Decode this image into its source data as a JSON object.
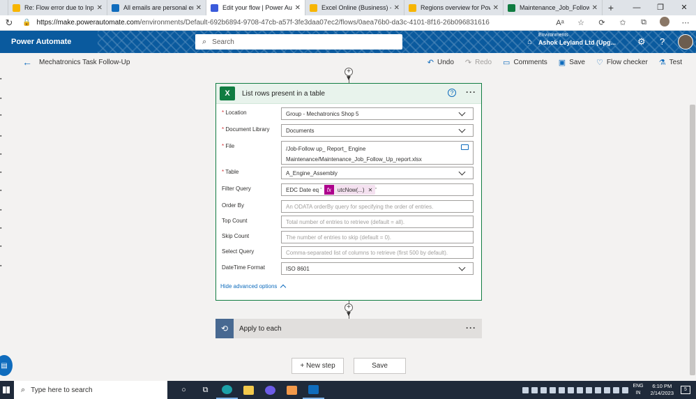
{
  "browser": {
    "tabs": [
      {
        "label": "Re: Flow error due to Input file",
        "color": "#f7b500"
      },
      {
        "label": "All emails are personal emails",
        "color": "#0f6cbd"
      },
      {
        "label": "Edit your flow | Power Automate",
        "color": "#3b5bdb",
        "active": true
      },
      {
        "label": "Excel Online (Business) - Conn",
        "color": "#f7b500"
      },
      {
        "label": "Regions overview for Power Au",
        "color": "#f7b500"
      },
      {
        "label": "Maintenance_Job_Follow_Up",
        "color": "#107c41"
      }
    ],
    "url_host": "https://make.powerautomate.com",
    "url_path": "/environments/Default-692b6894-9708-47cb-a57f-3fe3daa07ec2/flows/0aea76b0-da3c-4101-8f16-26b096831616"
  },
  "header": {
    "app_name": "Power Automate",
    "search_placeholder": "Search",
    "env_label": "Environments",
    "env_name": "Ashok Leyland Ltd (Upg..."
  },
  "cmdbar": {
    "flow_name": "Mechatronics Task Follow-Up",
    "undo": "Undo",
    "redo": "Redo",
    "comments": "Comments",
    "save": "Save",
    "flow_checker": "Flow checker",
    "test": "Test"
  },
  "action": {
    "title": "List rows present in a table",
    "location_label": "Location",
    "location_value": "Group - Mechatronics Shop 5",
    "doclib_label": "Document Library",
    "doclib_value": "Documents",
    "file_label": "File",
    "file_line1": "/Job-Follow up_ Report_ Engine",
    "file_line2": "Maintenance/Maintenance_Job_Follow_Up_report.xlsx",
    "table_label": "Table",
    "table_value": "A_Engine_Assembly",
    "filter_label": "Filter Query",
    "filter_prefix": "EDC Date eq '",
    "filter_token": "utcNow(...)",
    "filter_suffix": "'",
    "orderby_label": "Order By",
    "orderby_placeholder": "An ODATA orderBy query for specifying the order of entries.",
    "top_label": "Top Count",
    "top_placeholder": "Total number of entries to retrieve (default = all).",
    "skip_label": "Skip Count",
    "skip_placeholder": "The number of entries to skip (default = 0).",
    "select_label": "Select Query",
    "select_placeholder": "Comma-separated list of columns to retrieve (first 500 by default).",
    "datetime_label": "DateTime Format",
    "datetime_value": "ISO 8601",
    "advanced_link": "Hide advanced options"
  },
  "apply": {
    "title": "Apply to each"
  },
  "footer": {
    "new_step": "+ New step",
    "save": "Save"
  },
  "taskbar": {
    "search_placeholder": "Type here to search",
    "lang_line1": "ENG",
    "lang_line2": "IN",
    "time": "6:10 PM",
    "date": "2/14/2023",
    "notifications": "5"
  }
}
